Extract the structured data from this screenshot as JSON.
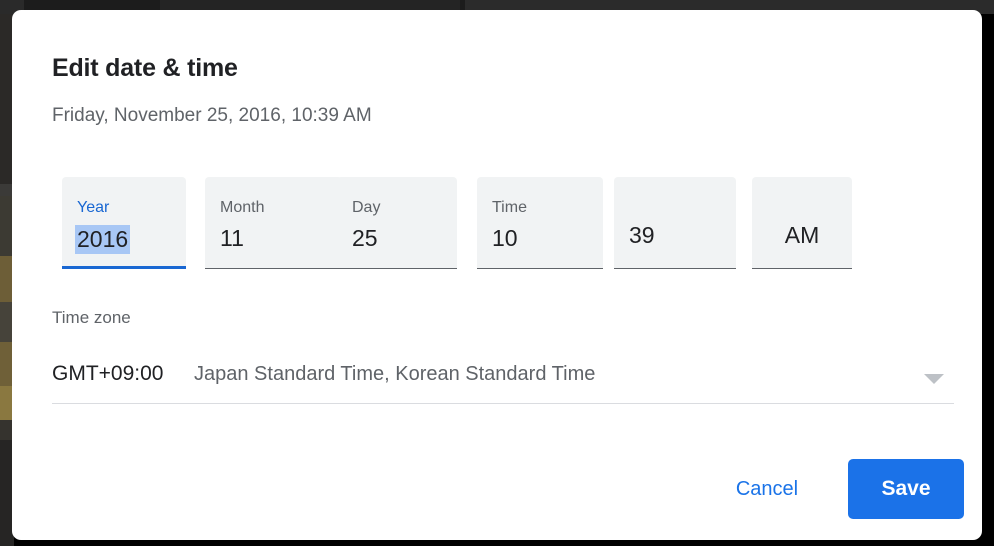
{
  "dialog": {
    "title": "Edit date & time",
    "subtitle": "Friday, November 25, 2016, 10:39 AM"
  },
  "fields": {
    "year": {
      "label": "Year",
      "value": "2016"
    },
    "month": {
      "label": "Month",
      "value": "11"
    },
    "day": {
      "label": "Day",
      "value": "25"
    },
    "hour": {
      "label": "Time",
      "value": "10"
    },
    "separator": ":",
    "minute": {
      "value": "39"
    },
    "meridiem": {
      "value": "AM"
    }
  },
  "timezone": {
    "label": "Time zone",
    "offset": "GMT+09:00",
    "name": "Japan Standard Time, Korean Standard Time",
    "caret_icon": "chevron-down-icon"
  },
  "actions": {
    "cancel_label": "Cancel",
    "save_label": "Save"
  },
  "colors": {
    "accent": "#1a73e8",
    "focus_underline": "#1967d2",
    "selection": "#a8c7f5",
    "field_background": "#f1f3f4",
    "text_primary": "#202124",
    "text_secondary": "#5f6368"
  }
}
